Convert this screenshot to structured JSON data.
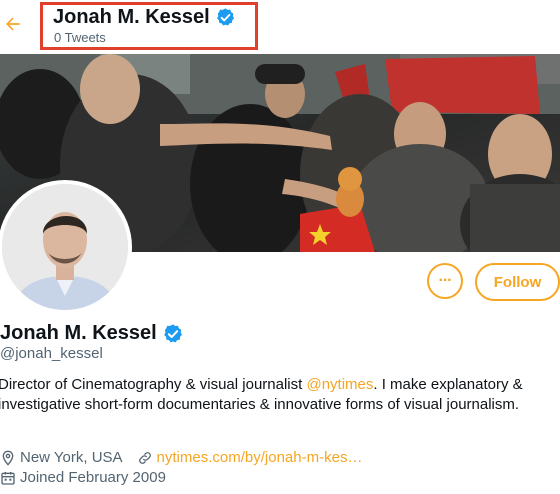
{
  "header": {
    "title": "Jonah M. Kessel",
    "subtitle": "0 Tweets"
  },
  "profile": {
    "name": "Jonah M. Kessel",
    "handle": "@jonah_kessel",
    "bio_before": "Director of Cinematography & visual journalist ",
    "bio_mention": "@nytimes",
    "bio_after": ". I make explanatory & investigative short-form documentaries & innovative forms of visual journalism.",
    "location": "New York, USA",
    "website": "nytimes.com/by/jonah-m-kes…",
    "joined": "Joined February 2009"
  },
  "actions": {
    "more_label": "···",
    "follow_label": "Follow"
  },
  "colors": {
    "accent": "#f5a623",
    "verified": "#1d9bf0",
    "highlight": "#e0402b"
  }
}
